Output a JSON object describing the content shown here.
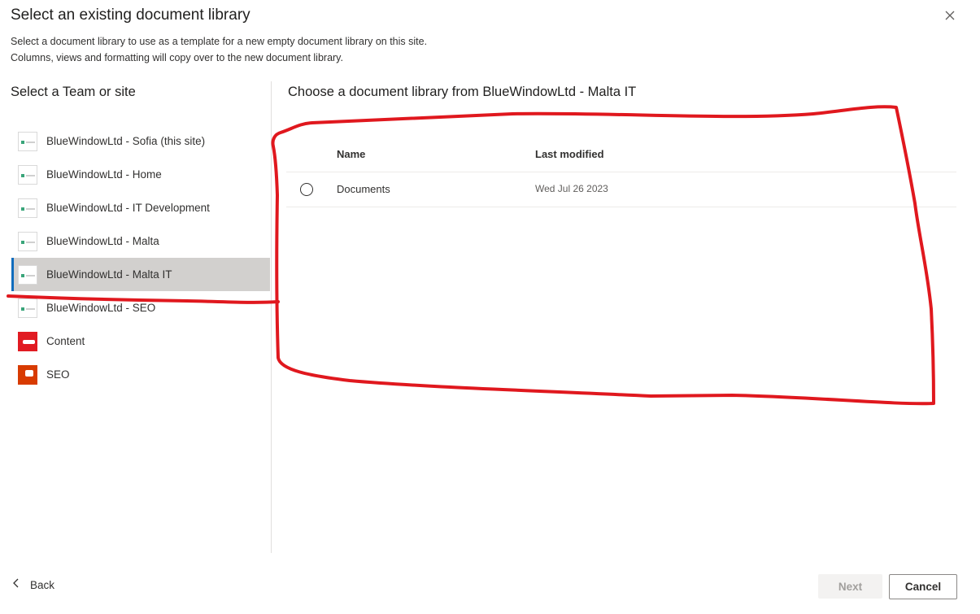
{
  "dialog": {
    "title": "Select an existing document library",
    "description_line1": "Select a document library to use as a template for a new empty document library on this site.",
    "description_line2": "Columns, views and formatting will copy over to the new document library."
  },
  "left_panel": {
    "heading": "Select a Team or site",
    "sites": [
      {
        "label": "BlueWindowLtd - Sofia (this site)",
        "icon": "site-thumbnail"
      },
      {
        "label": "BlueWindowLtd - Home",
        "icon": "site-thumbnail"
      },
      {
        "label": "BlueWindowLtd - IT Development",
        "icon": "site-thumbnail"
      },
      {
        "label": "BlueWindowLtd - Malta",
        "icon": "site-thumbnail"
      },
      {
        "label": "BlueWindowLtd - Malta IT",
        "icon": "site-thumbnail",
        "selected": true
      },
      {
        "label": "BlueWindowLtd - SEO",
        "icon": "site-thumbnail"
      },
      {
        "label": "Content",
        "icon": "red-site-tile"
      },
      {
        "label": "SEO",
        "icon": "orange-site-tile"
      }
    ]
  },
  "right_panel": {
    "heading": "Choose a document library from BlueWindowLtd - Malta IT",
    "columns": {
      "name": "Name",
      "modified": "Last modified"
    },
    "rows": [
      {
        "name": "Documents",
        "modified": "Wed Jul 26 2023"
      }
    ]
  },
  "footer": {
    "back_label": "Back",
    "next_label": "Next",
    "cancel_label": "Cancel"
  },
  "colors": {
    "accent": "#0f6cbd",
    "selected_bg": "#d2d0ce",
    "annotation": "#e0181e"
  },
  "icons": {
    "close": "close-icon",
    "back": "chevron-left-icon",
    "radio": "radio-button"
  }
}
